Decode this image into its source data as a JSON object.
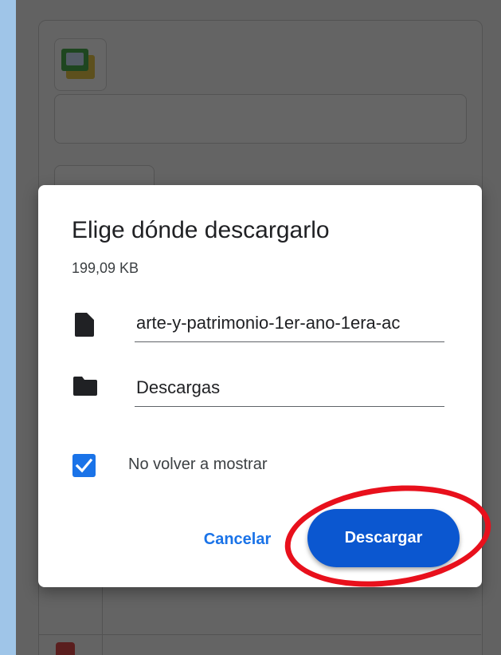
{
  "dialog": {
    "title": "Elige dónde descargarlo",
    "file_size": "199,09 KB",
    "file_name": "arte-y-patrimonio-1er-ano-1era-ac",
    "folder": "Descargas",
    "checkbox_label": "No volver a mostrar",
    "checkbox_checked": true,
    "cancel_label": "Cancelar",
    "download_label": "Descargar"
  },
  "colors": {
    "accent": "#1a73e8",
    "primary_button": "#0b57d0",
    "highlight": "#e8101c"
  },
  "icons": [
    "file-icon",
    "folder-icon",
    "checkmark-icon"
  ]
}
